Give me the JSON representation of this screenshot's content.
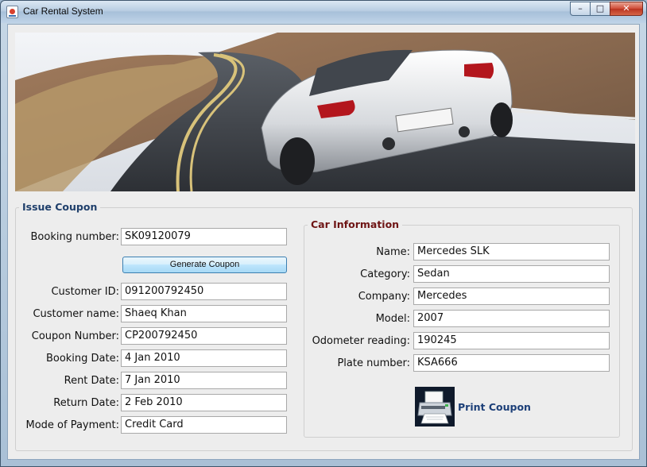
{
  "window": {
    "title": "Car Rental System",
    "controls": {
      "minimize": "–",
      "maximize": "□",
      "close": "✕"
    }
  },
  "banner": {
    "image": "convertible sports car on a winding mountain road"
  },
  "issue_coupon": {
    "title": "Issue Coupon",
    "booking_number": {
      "label": "Booking number:",
      "value": "SK09120079"
    },
    "generate_button": "Generate Coupon",
    "fields": [
      {
        "label": "Customer ID:",
        "value": "091200792450"
      },
      {
        "label": "Customer name:",
        "value": "Shaeq Khan"
      },
      {
        "label": "Coupon Number:",
        "value": "CP200792450"
      },
      {
        "label": "Booking Date:",
        "value": "4 Jan 2010"
      },
      {
        "label": "Rent Date:",
        "value": "7 Jan 2010"
      },
      {
        "label": "Return Date:",
        "value": "2 Feb 2010"
      },
      {
        "label": "Mode of Payment:",
        "value": "Credit Card"
      }
    ]
  },
  "car_information": {
    "title": "Car Information",
    "fields": [
      {
        "label": "Name:",
        "value": "Mercedes SLK"
      },
      {
        "label": "Category:",
        "value": "Sedan"
      },
      {
        "label": "Company:",
        "value": "Mercedes"
      },
      {
        "label": "Model:",
        "value": "2007"
      },
      {
        "label": "Odometer reading:",
        "value": "190245"
      },
      {
        "label": "Plate number:",
        "value": "KSA666"
      }
    ],
    "print_button": {
      "label": "Print Coupon",
      "icon": "printer-icon"
    }
  },
  "colors": {
    "issue_title": "#1f3f6b",
    "car_info_title": "#6e1414",
    "print_label": "#1c3f78"
  }
}
